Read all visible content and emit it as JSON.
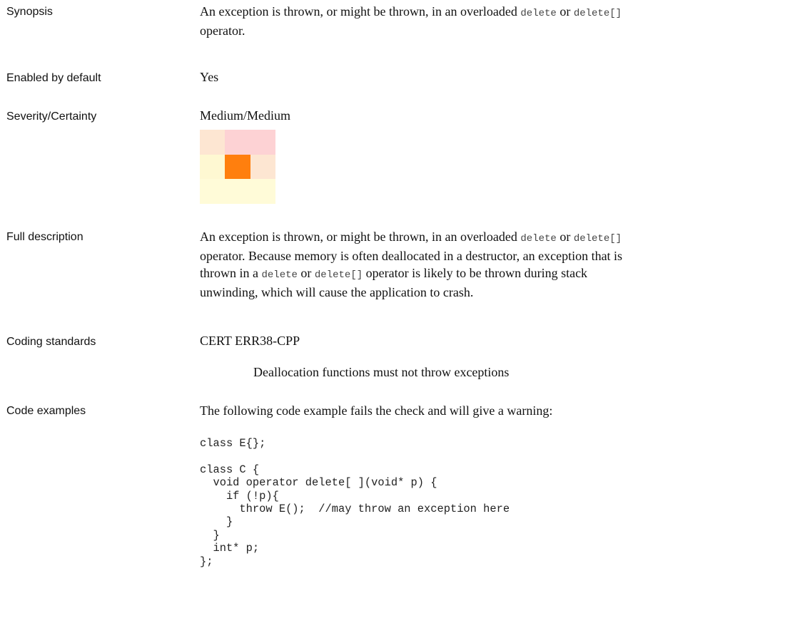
{
  "rows": {
    "synopsis": {
      "label": "Synopsis",
      "t1": "An exception is thrown, or might be thrown, in an overloaded ",
      "c1": "delete",
      "t2": " or ",
      "c2": "delete[]",
      "t3": "operator."
    },
    "enabled": {
      "label": "Enabled by default",
      "value": "Yes"
    },
    "severity": {
      "label": "Severity/Certainty",
      "value": "Medium/Medium",
      "grid_colors": [
        "#fde6d2",
        "#fdd2d4",
        "#fdd2d4",
        "#fef8d2",
        "#ff7f0e",
        "#fde6d2",
        "#fffbd8",
        "#fffbd8",
        "#fffbd8"
      ]
    },
    "full_description": {
      "label": "Full description",
      "t1": " An exception is thrown, or might be thrown, in an overloaded ",
      "c1": "delete",
      "t2": " or ",
      "c2": "delete[]",
      "t3": "operator. Because memory is often deallocated in a destructor, an exception that is",
      "t4": "thrown in a ",
      "c3": "delete",
      "t5": " or ",
      "c4": "delete[]",
      "t6": " operator is likely to be thrown during stack",
      "t7": "unwinding, which will cause the application to crash."
    },
    "coding_standards": {
      "label": "Coding standards",
      "standard": "CERT ERR38-CPP",
      "rule": "Deallocation functions must not throw exceptions"
    },
    "code_examples": {
      "label": "Code examples",
      "intro": "The following code example fails the check and will give a warning:",
      "code": "class E{};\n\nclass C {\n  void operator delete[ ](void* p) {\n    if (!p){\n      throw E();  //may throw an exception here\n    }\n  }\n  int* p;\n};"
    }
  }
}
